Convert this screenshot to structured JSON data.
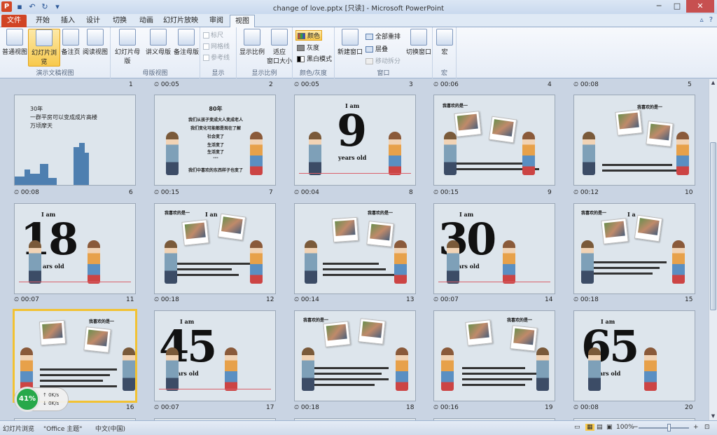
{
  "window": {
    "title": "change of love.pptx [只读] - Microsoft PowerPoint",
    "app_logo": "P"
  },
  "tabs": {
    "file": "文件",
    "items": [
      "开始",
      "插入",
      "设计",
      "切换",
      "动画",
      "幻灯片放映",
      "审阅",
      "视图"
    ],
    "active": "视图"
  },
  "ribbon": {
    "groups": {
      "presentation_views": "演示文稿视图",
      "master_views": "母版视图",
      "show": "显示",
      "zoom": "显示比例",
      "color": "颜色/灰度",
      "window": "窗口",
      "macros": "宏"
    },
    "buttons": {
      "normal": "普通视图",
      "slide_sorter": "幻灯片浏览",
      "notes_page": "备注页",
      "reading_view": "阅读视图",
      "slide_master": "幻灯片母版",
      "handout_master": "讲义母版",
      "notes_master": "备注母版",
      "ruler": "标尺",
      "gridlines": "网格线",
      "guides": "参考线",
      "zoom": "显示比例",
      "fit_window_1": "适应",
      "fit_window_2": "窗口大小",
      "color": "颜色",
      "grayscale": "灰度",
      "bw": "黑白模式",
      "new_window": "新建窗口",
      "arrange_all": "全部重排",
      "cascade": "层叠",
      "move_split": "移动拆分",
      "switch_windows": "切换窗口",
      "macros": "宏"
    }
  },
  "slides": [
    {
      "num": "1",
      "time": ""
    },
    {
      "num": "2",
      "time": "00:05"
    },
    {
      "num": "3",
      "time": "00:05"
    },
    {
      "num": "4",
      "time": "00:06"
    },
    {
      "num": "5",
      "time": "00:08"
    },
    {
      "num": "6",
      "time": "00:08"
    },
    {
      "num": "7",
      "time": "00:15"
    },
    {
      "num": "8",
      "time": "00:04"
    },
    {
      "num": "9",
      "time": "00:15"
    },
    {
      "num": "10",
      "time": "00:12"
    },
    {
      "num": "11",
      "time": "00:07"
    },
    {
      "num": "12",
      "time": "00:18"
    },
    {
      "num": "13",
      "time": "00:14"
    },
    {
      "num": "14",
      "time": "00:07"
    },
    {
      "num": "15",
      "time": "00:18"
    },
    {
      "num": "16",
      "time": ""
    },
    {
      "num": "17",
      "time": "00:07"
    },
    {
      "num": "18",
      "time": "00:18"
    },
    {
      "num": "19",
      "time": "00:16"
    },
    {
      "num": "20",
      "time": "00:08"
    }
  ],
  "bottom_row_times": [
    "00:07",
    "00:18",
    "00:16",
    "00:08"
  ],
  "slide_content": {
    "s1": {
      "line1": "30年",
      "line2": "一群平房可以变成成片高楼",
      "line3": "万顷摩天"
    },
    "s2": {
      "title": "80年",
      "l1": "我们从孩子变成大人变成老人",
      "l2": "我们变化可能都是现在了解",
      "l3": "社会变了",
      "l4": "生活变了",
      "l5": "生活变了",
      "l6": "---",
      "l7": "我们中喜欢的东西样子也变了"
    },
    "s3": {
      "iam": "I am",
      "num": "9",
      "yrs": "years old"
    },
    "s4": {
      "hdr": "我喜欢的是一"
    },
    "s5": {
      "hdr": "我喜欢的是一"
    },
    "s6": {
      "iam": "I am",
      "num": "18",
      "yrs": "ars old"
    },
    "s7": {
      "hdr": "我喜欢的是一",
      "iam": "I an"
    },
    "s8": {
      "hdr": "我喜欢的是一"
    },
    "s9": {
      "iam": "I am",
      "num": "30",
      "yrs": "ars old"
    },
    "s10": {
      "hdr": "我喜欢的是一",
      "iam": "I a"
    },
    "s11": {
      "hdr": "我喜欢的是一"
    },
    "s12": {
      "iam": "I am",
      "num": "45",
      "yrs": "ars old"
    },
    "s13": {
      "hdr": "我喜欢的是一"
    },
    "s14": {
      "hdr": "我喜欢的是一"
    },
    "s15": {
      "iam": "I am",
      "num": "65",
      "yrs": "years old"
    }
  },
  "status": {
    "view": "幻灯片浏览",
    "theme": "\"Office 主题\"",
    "lang": "中文(中国)",
    "zoom": "100%",
    "zoom_minus": "−",
    "zoom_plus": "+"
  },
  "net_widget": {
    "percent": "41%",
    "up": "0K/s",
    "down": "0K/s"
  }
}
